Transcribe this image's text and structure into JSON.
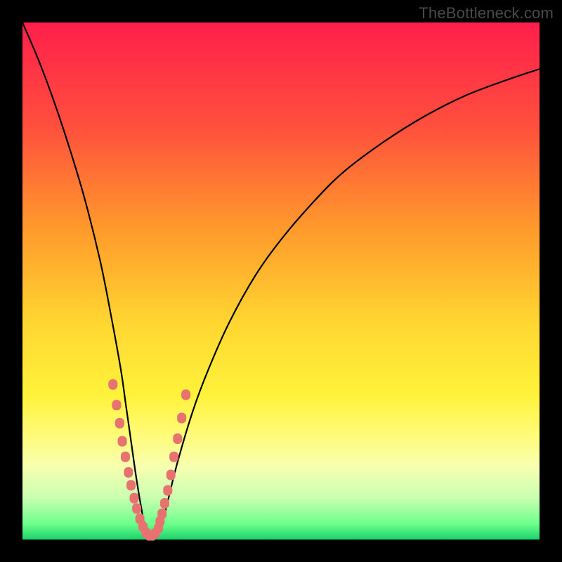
{
  "watermark": "TheBottleneck.com",
  "colors": {
    "frame": "#000000",
    "gradient_stops": [
      {
        "pct": 0,
        "color": "#ff1f4b"
      },
      {
        "pct": 20,
        "color": "#ff4f3d"
      },
      {
        "pct": 40,
        "color": "#ff9a2b"
      },
      {
        "pct": 58,
        "color": "#ffd631"
      },
      {
        "pct": 72,
        "color": "#fff23a"
      },
      {
        "pct": 80,
        "color": "#fffb7a"
      },
      {
        "pct": 86,
        "color": "#f7ffb0"
      },
      {
        "pct": 92,
        "color": "#c8ffb0"
      },
      {
        "pct": 97,
        "color": "#6cff8a"
      },
      {
        "pct": 100,
        "color": "#1bd36a"
      }
    ],
    "curve": "#000000",
    "markers": "#e8726f"
  },
  "chart_data": {
    "type": "line",
    "title": "",
    "xlabel": "",
    "ylabel": "",
    "xlim": [
      0,
      100
    ],
    "ylim": [
      0,
      100
    ],
    "grid": false,
    "legend": false,
    "annotations": [
      "TheBottleneck.com"
    ],
    "notes": "V-shaped bottleneck curve. y is a mismatch/bottleneck percentage (100=worst, 0=best). Minimum (y≈0) occurs near x≈24. Curve rises steeply toward x=0 and more gently toward x=100.",
    "series": [
      {
        "name": "bottleneck-curve",
        "x": [
          0,
          3,
          6,
          9,
          12,
          15,
          17,
          19,
          20,
          21,
          22,
          23,
          24,
          25,
          26,
          27,
          28,
          30,
          33,
          36,
          40,
          45,
          50,
          56,
          62,
          70,
          78,
          86,
          94,
          100
        ],
        "y": [
          100,
          93,
          85,
          76,
          66,
          54,
          44,
          33,
          26,
          19,
          12,
          6,
          1,
          0,
          1,
          3,
          7,
          15,
          25,
          33,
          42,
          51,
          58,
          65,
          71,
          77,
          82,
          86,
          89,
          91
        ]
      }
    ],
    "markers": {
      "name": "highlighted-points",
      "note": "Pink rounded markers clustered along both arms near the minimum (roughly y in [3,30]) and a short run across the bottom.",
      "x": [
        17.5,
        18.2,
        18.8,
        19.3,
        19.9,
        20.5,
        21.0,
        21.6,
        22.1,
        22.7,
        23.3,
        23.9,
        24.5,
        25.1,
        25.7,
        26.3,
        26.6,
        27.0,
        27.5,
        28.1,
        28.7,
        29.3,
        30.0,
        30.8,
        31.6
      ],
      "y": [
        30.0,
        26.0,
        22.5,
        19.0,
        16.0,
        13.0,
        10.5,
        8.0,
        6.0,
        4.0,
        2.5,
        1.3,
        0.8,
        0.8,
        1.2,
        2.2,
        3.5,
        5.0,
        7.0,
        9.5,
        12.5,
        16.0,
        19.5,
        23.5,
        28.0
      ]
    }
  }
}
